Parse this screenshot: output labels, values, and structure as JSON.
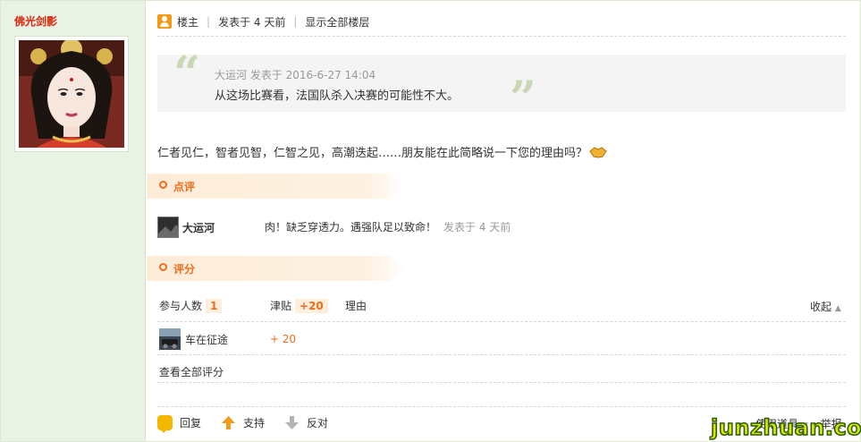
{
  "author": {
    "name": "佛光剑影"
  },
  "post": {
    "floor_label": "楼主",
    "posted": "发表于 4 天前",
    "show_all": "显示全部楼层",
    "quote": {
      "author_meta": "大运河 发表于 2016-6-27 14:04",
      "text": "从这场比赛看，法国队杀入决赛的可能性不大。"
    },
    "body": "仁者见仁，智者见智，仁智之见，高潮迭起……朋友能在此简略说一下您的理由吗？"
  },
  "comment_section": {
    "title": "点评",
    "comment": {
      "user": "大运河",
      "text": "肉！缺乏穿透力。遇强队足以致命！",
      "time": "发表于 4 天前"
    }
  },
  "rating_section": {
    "title": "评分",
    "participants_label": "参与人数",
    "participants_count": "1",
    "allowance_label": "津贴",
    "allowance_total": "+20",
    "reason_label": "理由",
    "collapse_label": "收起",
    "rows": [
      {
        "user": "车在征途",
        "score": "+ 20"
      }
    ],
    "view_all": "查看全部评分"
  },
  "actions": {
    "reply": "回复",
    "support": "支持",
    "oppose": "反对",
    "use_tool": "使用道具",
    "report": "举报"
  },
  "watermark": "junzhuan.com"
}
